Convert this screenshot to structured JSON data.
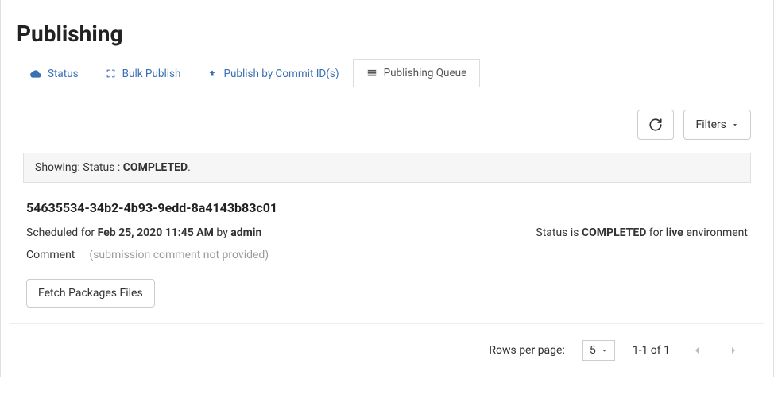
{
  "page": {
    "title": "Publishing"
  },
  "tabs": {
    "status": "Status",
    "bulk": "Bulk Publish",
    "by_commit": "Publish by Commit ID(s)",
    "queue": "Publishing Queue"
  },
  "toolbar": {
    "filters_label": "Filters"
  },
  "filter_bar": {
    "showing_prefix": "Showing: Status : ",
    "status_value": "COMPLETED",
    "suffix": "."
  },
  "card": {
    "id": "54635534-34b2-4b93-9edd-8a4143b83c01",
    "scheduled_prefix": "Scheduled for ",
    "scheduled_date": "Feb 25, 2020 11:45 AM",
    "by_text": " by ",
    "author": "admin",
    "status_prefix": "Status is ",
    "status_value": "COMPLETED",
    "for_text": " for ",
    "environment": "live",
    "env_suffix": " environment",
    "comment_label": "Comment",
    "comment_placeholder": "(submission comment not provided)",
    "fetch_button": "Fetch Packages Files"
  },
  "pagination": {
    "rows_label": "Rows per page:",
    "rows_value": "5",
    "range": "1-1 of 1"
  }
}
